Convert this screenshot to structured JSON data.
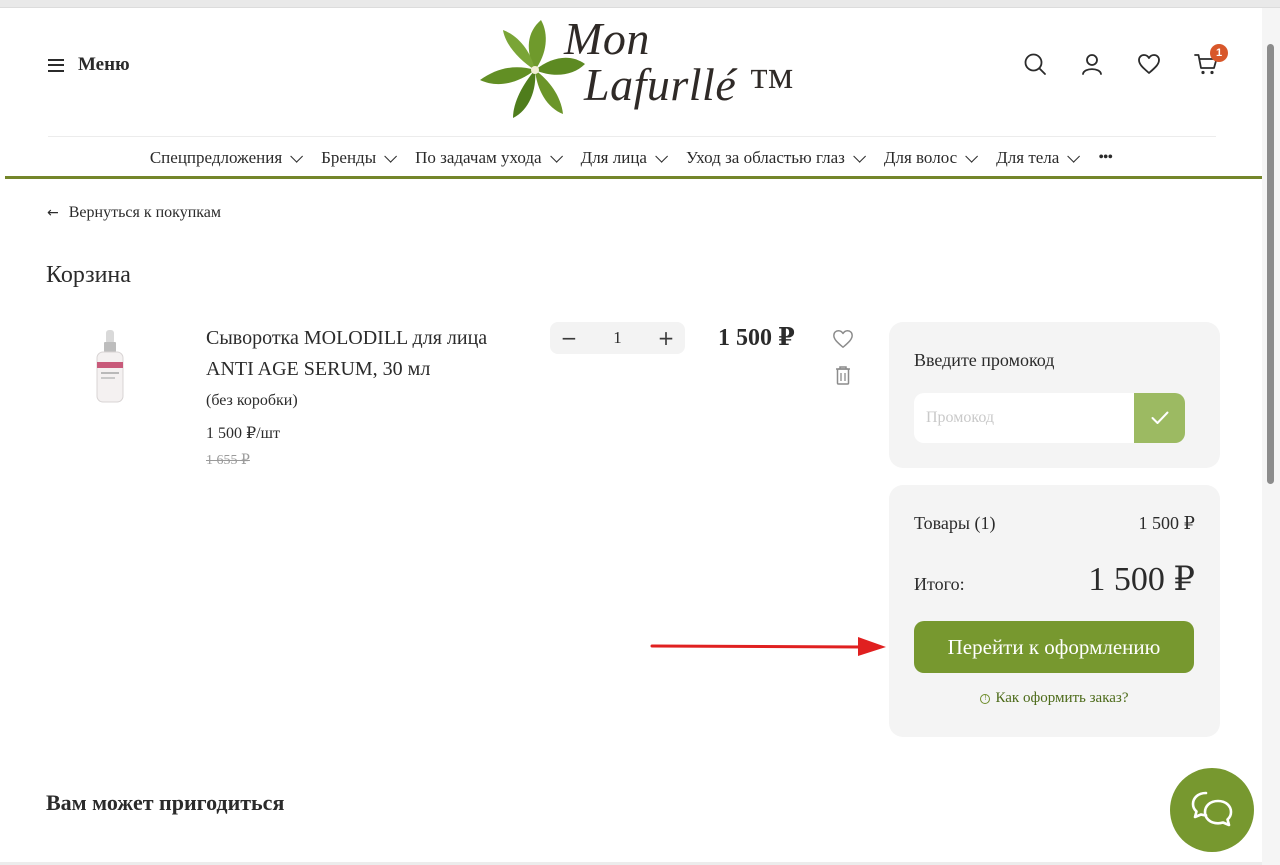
{
  "header": {
    "menu_label": "Меню",
    "logo_line1": "Mon",
    "logo_line2": "Lafurllé ™",
    "cart_count": "1"
  },
  "nav": {
    "items": [
      {
        "label": "Спецпредложения"
      },
      {
        "label": "Бренды"
      },
      {
        "label": "По задачам ухода"
      },
      {
        "label": "Для лица"
      },
      {
        "label": "Уход за областью глаз"
      },
      {
        "label": "Для волос"
      },
      {
        "label": "Для тела"
      }
    ],
    "more": "•••"
  },
  "back_link": "Вернуться к покупкам",
  "page_title": "Корзина",
  "cart_item": {
    "name": "Сыворотка MOLODILL для лица ANTI AGE SERUM, 30 мл",
    "variant": "(без коробки)",
    "unit_price": "1 500 ₽/шт",
    "old_price": "1 655 ₽",
    "quantity": "1",
    "price": "1 500 ₽",
    "image_label": "MOLODILL"
  },
  "promo": {
    "title": "Введите промокод",
    "placeholder": "Промокод"
  },
  "summary": {
    "items_label": "Товары (1)",
    "items_value": "1 500 ₽",
    "total_label": "Итого:",
    "total_value": "1 500 ₽",
    "checkout_label": "Перейти к оформлению",
    "howto_label": "Как оформить заказ?"
  },
  "recommend_title": "Вам может пригодиться",
  "colors": {
    "brand_green": "#77982f",
    "nav_line": "#74862a",
    "promo_apply": "#9cba62",
    "badge": "#d8572a",
    "annotation_arrow": "#e02020"
  }
}
